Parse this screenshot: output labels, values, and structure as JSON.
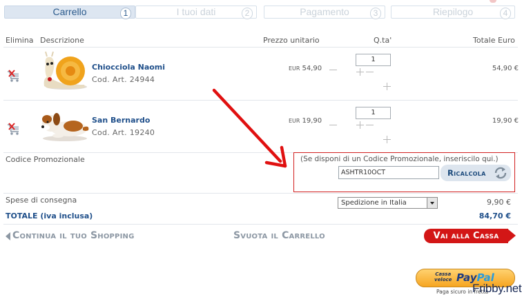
{
  "steps": [
    {
      "label": "Carrello",
      "num": "1"
    },
    {
      "label": "I tuoi dati",
      "num": "2"
    },
    {
      "label": "Pagamento",
      "num": "3"
    },
    {
      "label": "Riepilogo",
      "num": "4"
    }
  ],
  "columns": {
    "elimina": "Elimina",
    "descrizione": "Descrizione",
    "prezzo": "Prezzo unitario",
    "qta": "Q.ta'",
    "totale": "Totale Euro"
  },
  "items": [
    {
      "name": "Chiocciola Naomi",
      "code": "Cod. Art.  24944",
      "currency": "EUR",
      "unit_price": "54,90",
      "qty": "1",
      "total": "54,90 €"
    },
    {
      "name": "San Bernardo",
      "code": "Cod. Art.  19240",
      "currency": "EUR",
      "unit_price": "19,90",
      "qty": "1",
      "total": "19,90 €"
    }
  ],
  "promo": {
    "label": "Codice Promozionale",
    "hint": "(Se disponi di un Codice Promozionale, inseriscilo qui.)",
    "code_value": "ASHTR10OCT",
    "button": "Ricalcola"
  },
  "shipping": {
    "label": "Spese di consegna",
    "method": "Spedizione in Italia",
    "cost": "9,90 €"
  },
  "totals": {
    "label": "TOTALE (iva inclusa)",
    "value": "84,70 €"
  },
  "actions": {
    "continue": "Continua il tuo Shopping",
    "empty": "Svuota il Carrello",
    "checkout": "Vai alla Cassa"
  },
  "paypal": {
    "line1": "Cassa",
    "line2": "veloce",
    "brand_a": "Pay",
    "brand_b": "Pal",
    "tagline": "Paga sicuro in fretta"
  },
  "watermark": "Fribby.net",
  "colors": {
    "accent_blue": "#1f4f8a",
    "alert_red": "#d21f1f",
    "checkout_red": "#d31616"
  }
}
